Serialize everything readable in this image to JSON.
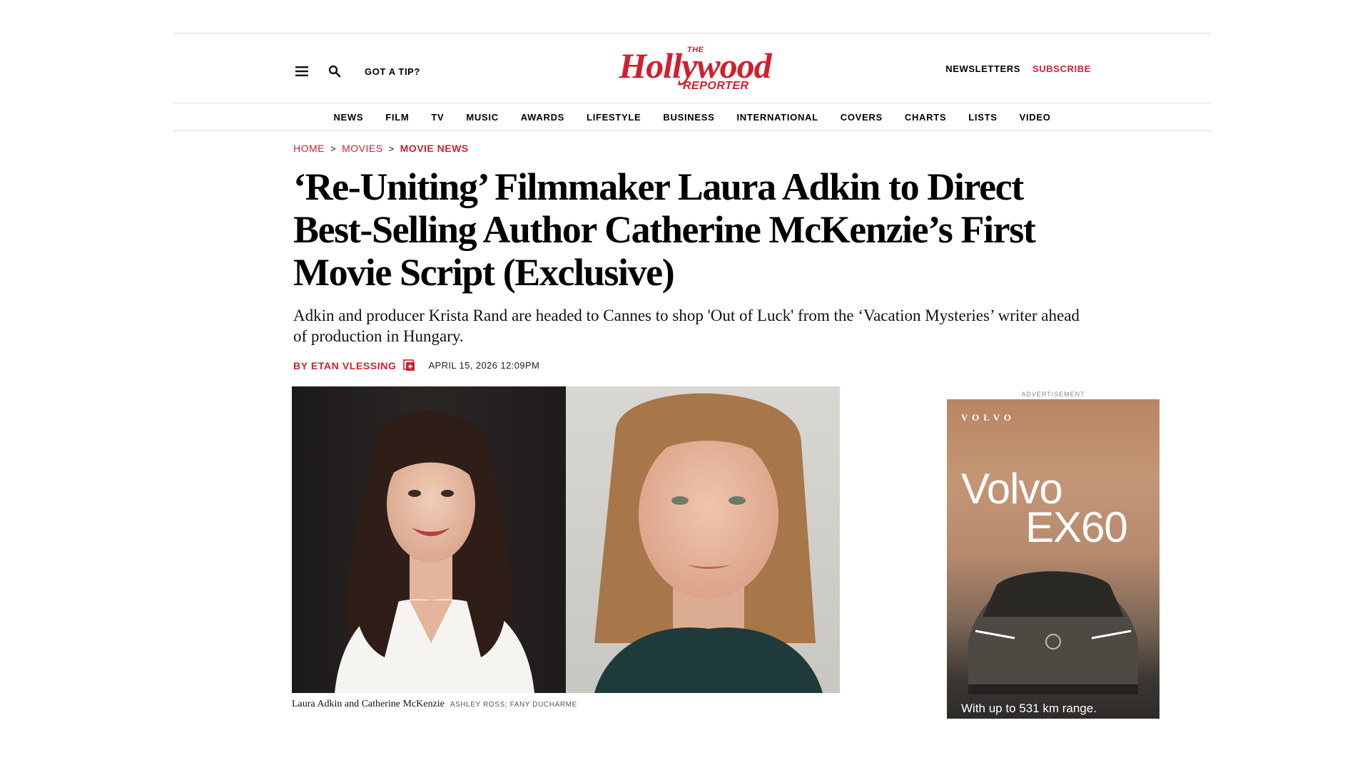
{
  "header": {
    "tip_label": "GOT A TIP?",
    "logo": {
      "the": "THE",
      "main": "Hollywood",
      "reporter": "REPORTER"
    },
    "newsletters_label": "NEWSLETTERS",
    "subscribe_label": "SUBSCRIBE",
    "menu_icon": "hamburger-menu-icon",
    "search_icon": "search-icon"
  },
  "nav": [
    "NEWS",
    "FILM",
    "TV",
    "MUSIC",
    "AWARDS",
    "LIFESTYLE",
    "BUSINESS",
    "INTERNATIONAL",
    "COVERS",
    "CHARTS",
    "LISTS",
    "VIDEO"
  ],
  "breadcrumb": {
    "home": "HOME",
    "section": "MOVIES",
    "current": "MOVIE NEWS",
    "separator": ">"
  },
  "article": {
    "headline": "‘Re-Uniting’ Filmmaker Laura Adkin to Direct Best-Selling Author Catherine McKenzie’s First Movie Script (Exclusive)",
    "dek": "Adkin and producer Krista Rand are headed to Cannes to shop 'Out of Luck' from the ‘Vacation Mysteries’ writer ahead of production in Hungary.",
    "byline": "BY ETAN VLESSING",
    "date": "APRIL 15, 2026 12:09PM",
    "caption": "Laura Adkin and Catherine McKenzie",
    "credit": "ASHLEY ROSS; FANY DUCHARME"
  },
  "ad": {
    "label": "ADVERTISEMENT",
    "brand": "VOLVO",
    "title_line1": "Volvo",
    "title_line2": "EX60",
    "tagline": "With up to 531 km range."
  },
  "colors": {
    "accent": "#d0202e",
    "text": "#000000",
    "rule": "#dcdcdc"
  }
}
